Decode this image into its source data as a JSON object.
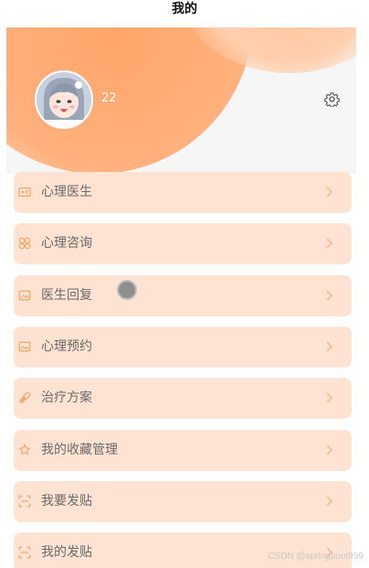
{
  "page": {
    "title": "我的"
  },
  "profile": {
    "username": "22"
  },
  "menu": [
    {
      "label": "心理医生",
      "icon": "id-card-icon"
    },
    {
      "label": "心理咨询",
      "icon": "grid-circles-icon"
    },
    {
      "label": "医生回复",
      "icon": "picture-icon"
    },
    {
      "label": "心理预约",
      "icon": "picture-icon"
    },
    {
      "label": "治疗方案",
      "icon": "pills-icon"
    },
    {
      "label": "我的收藏管理",
      "icon": "star-icon"
    },
    {
      "label": "我要发贴",
      "icon": "scan-icon"
    },
    {
      "label": "我的发贴",
      "icon": "scan-icon"
    }
  ],
  "colors": {
    "accent": "#ffa66a",
    "menu_bg": "#ffe3d2",
    "icon": "#f2a96b",
    "chevron": "#f2bb8f"
  },
  "watermark": "CSDN @springboot999"
}
